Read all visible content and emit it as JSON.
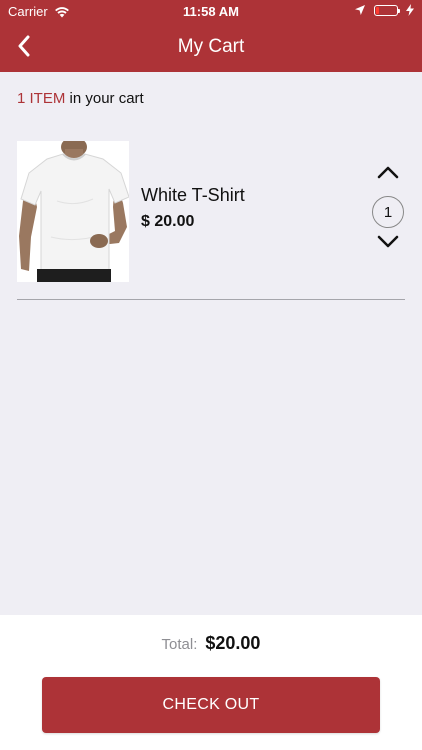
{
  "colors": {
    "accent": "#ad3337",
    "background": "#efeef4",
    "battery_low": "#ff3b30"
  },
  "status_bar": {
    "carrier": "Carrier",
    "time": "11:58 AM",
    "icons": [
      "wifi-icon",
      "location-arrow-icon",
      "battery-icon",
      "charging-bolt-icon"
    ],
    "battery_level": 0.15
  },
  "nav": {
    "title": "My Cart",
    "back_icon": "chevron-left-icon"
  },
  "cart": {
    "count": "1 ITEM",
    "count_suffix": "in your cart",
    "items": [
      {
        "name": "White T-Shirt",
        "price": "$ 20.00",
        "quantity": "1",
        "image": "white-tshirt-photo",
        "up_icon": "chevron-up-icon",
        "down_icon": "chevron-down-icon"
      }
    ]
  },
  "footer": {
    "total_label": "Total:",
    "total_value": "$20.00",
    "checkout_label": "CHECK OUT"
  }
}
